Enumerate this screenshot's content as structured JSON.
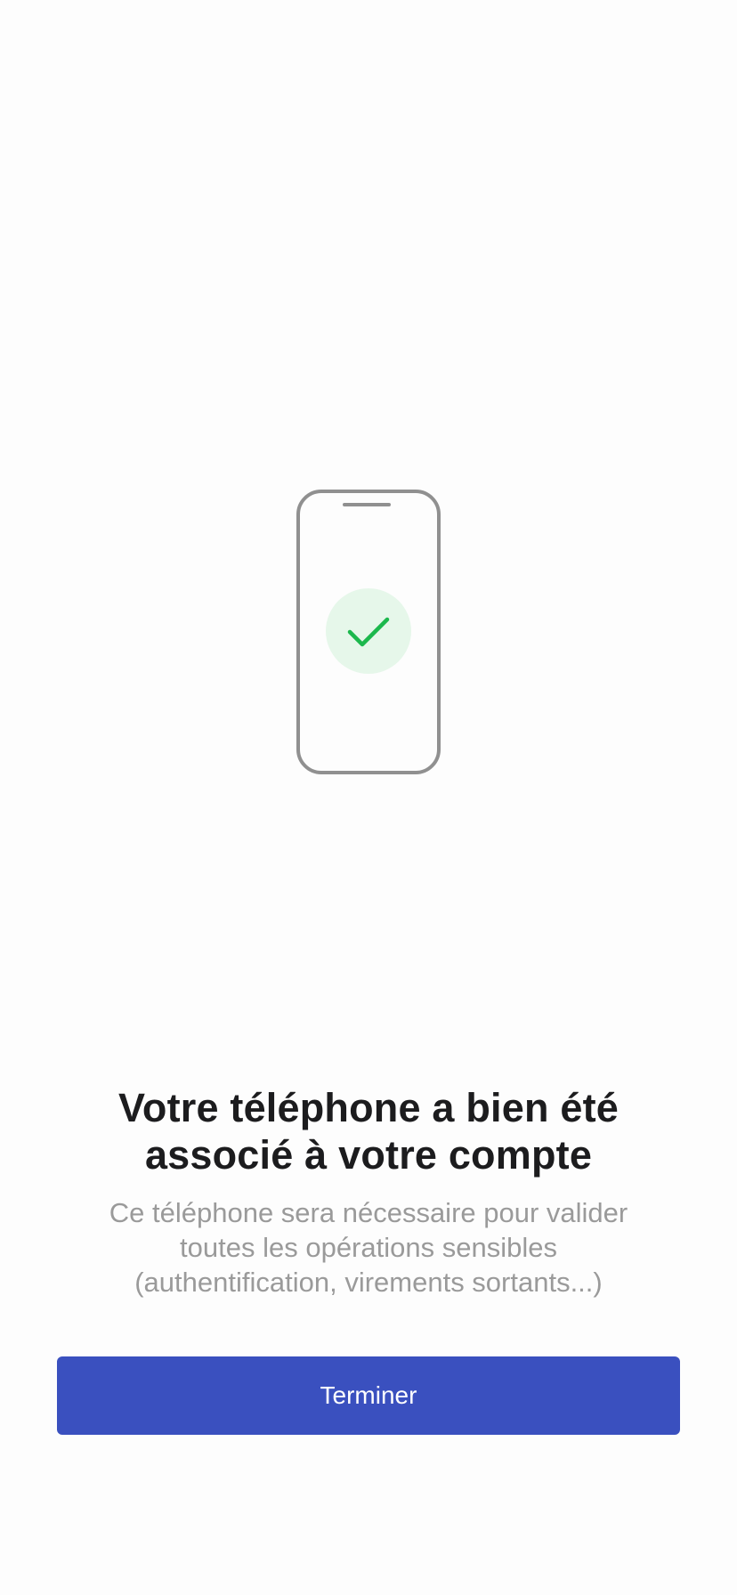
{
  "colors": {
    "background": "#fdfdfd",
    "accent": "#3a50bf",
    "success": "#1cb84d",
    "success_bg": "#e6f7ea",
    "phone_outline": "#909090",
    "title_text": "#1c1c1e",
    "subtitle_text": "#9a9a9a"
  },
  "illustration": {
    "icon": "phone-check-icon",
    "status": "success"
  },
  "content": {
    "title_line1": "Votre téléphone a bien été",
    "title_line2": "associé à votre compte",
    "subtitle_line1": "Ce téléphone sera nécessaire pour valider",
    "subtitle_line2": "toutes les opérations sensibles",
    "subtitle_line3": "(authentification, virements sortants...)"
  },
  "actions": {
    "finish_label": "Terminer"
  }
}
